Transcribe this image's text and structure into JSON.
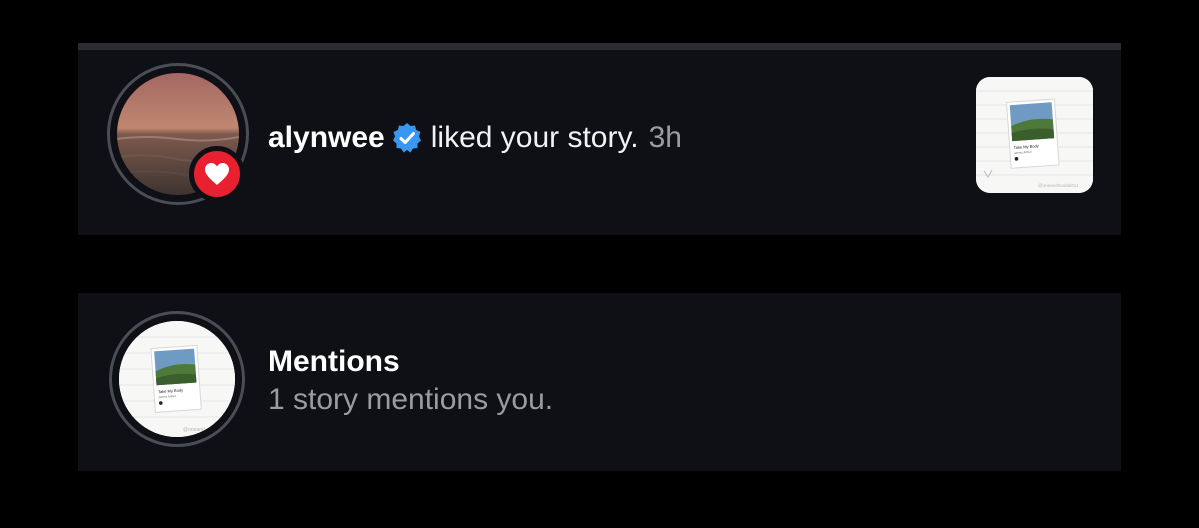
{
  "activity": {
    "like_notification": {
      "username": "alynwee",
      "verified": true,
      "action_text": "liked your story.",
      "time": "3h",
      "avatar_icon": "profile-photo",
      "badge_icon": "heart-icon",
      "badge_color": "#e8202f",
      "thumbnail": {
        "card_title": "Take My Body",
        "card_artist": "James Arthur",
        "watermark": "@oneandtroubleDct"
      }
    },
    "mentions": {
      "title": "Mentions",
      "subtitle": "1 story mentions you.",
      "watermark": "@oneand"
    }
  },
  "colors": {
    "background": "#000000",
    "card": "#0e1015",
    "verified_blue": "#3897f0",
    "secondary_text": "#9a9ca1"
  }
}
